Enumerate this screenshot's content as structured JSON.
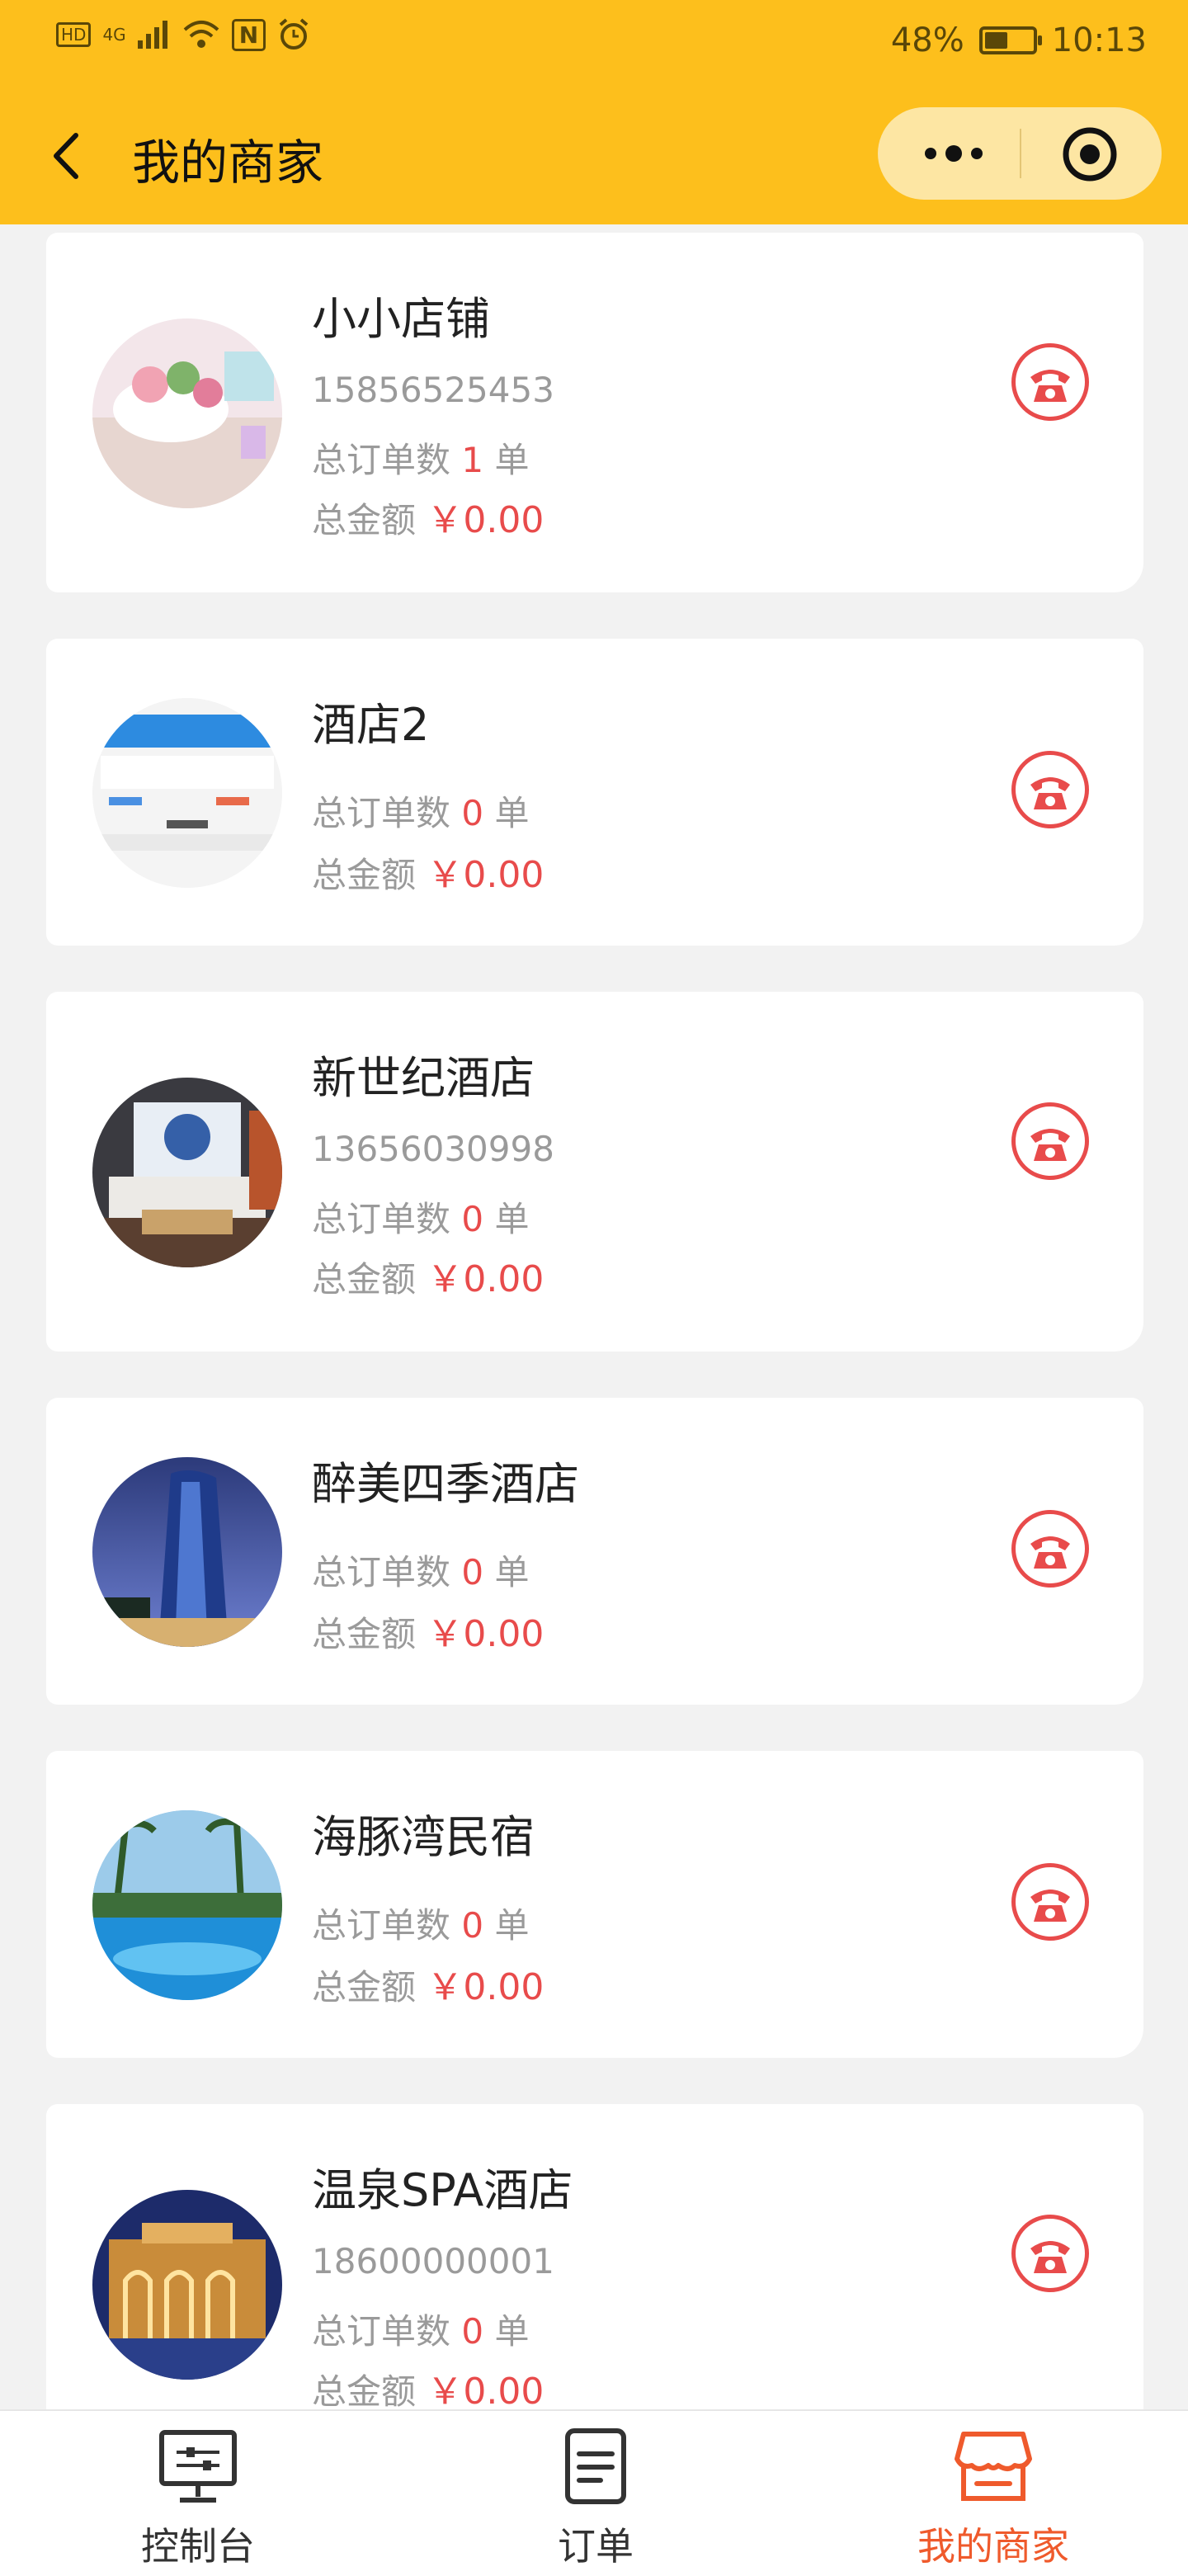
{
  "status_bar": {
    "hd": "HD",
    "network": "4G",
    "nfc": "N",
    "battery_pct": "48%",
    "battery_level": 0.48,
    "time": "10:13"
  },
  "navbar": {
    "title": "我的商家",
    "bg_color": "#fdbf1c"
  },
  "merchants": [
    {
      "name": "小小店铺",
      "phone": "15856525453",
      "orders_label": "总订单数",
      "orders": "1",
      "orders_unit": "单",
      "amount_label": "总金额",
      "amount": "￥0.00"
    },
    {
      "name": "酒店2",
      "phone": "",
      "orders_label": "总订单数",
      "orders": "0",
      "orders_unit": "单",
      "amount_label": "总金额",
      "amount": "￥0.00"
    },
    {
      "name": "新世纪酒店",
      "phone": "13656030998",
      "orders_label": "总订单数",
      "orders": "0",
      "orders_unit": "单",
      "amount_label": "总金额",
      "amount": "￥0.00"
    },
    {
      "name": "醉美四季酒店",
      "phone": "",
      "orders_label": "总订单数",
      "orders": "0",
      "orders_unit": "单",
      "amount_label": "总金额",
      "amount": "￥0.00"
    },
    {
      "name": "海豚湾民宿",
      "phone": "",
      "orders_label": "总订单数",
      "orders": "0",
      "orders_unit": "单",
      "amount_label": "总金额",
      "amount": "￥0.00"
    },
    {
      "name": "温泉SPA酒店",
      "phone": "18600000001",
      "orders_label": "总订单数",
      "orders": "0",
      "orders_unit": "单",
      "amount_label": "总金额",
      "amount": "￥0.00"
    }
  ],
  "tabbar": {
    "tabs": [
      {
        "label": "控制台",
        "icon": "monitor-icon",
        "active": false
      },
      {
        "label": "订单",
        "icon": "document-icon",
        "active": false
      },
      {
        "label": "我的商家",
        "icon": "store-icon",
        "active": true
      }
    ],
    "active_color": "#ef5a2c"
  },
  "colors": {
    "accent_red": "#e84b4b"
  }
}
